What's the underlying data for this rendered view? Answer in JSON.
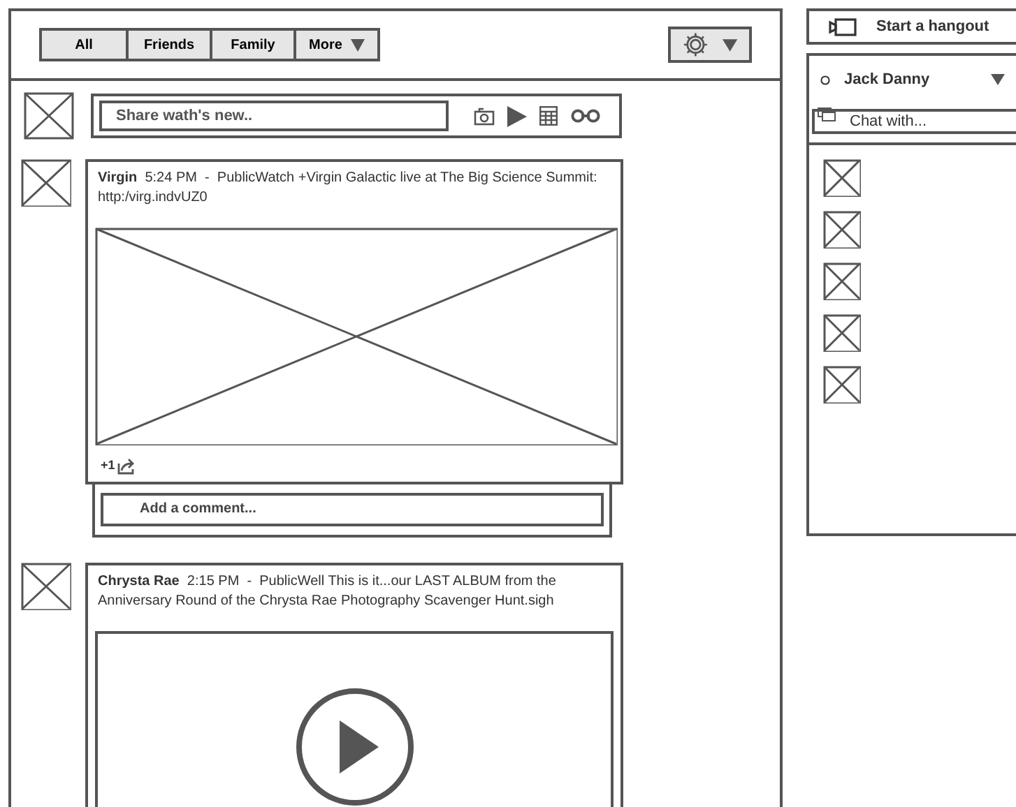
{
  "tabs": [
    {
      "label": "All"
    },
    {
      "label": "Friends"
    },
    {
      "label": "Family"
    },
    {
      "label": "More",
      "dropdown": true
    }
  ],
  "share": {
    "placeholder": "Share wath's new.."
  },
  "posts": [
    {
      "text": "**Virgin**  5:24 PM  -  PublicWatch +Virgin Galactic live at The Big Science Summit: http:/virg.indvUZ0",
      "kind": "image",
      "plus": "+1",
      "comment_placeholder": "Add a comment..."
    },
    {
      "text": "**Chrysta Rae**  2:15 PM  -  PublicWell This is it...our LAST ALBUM from the Anniversary Round of the Chrysta Rae Photography Scavenger Hunt.sigh",
      "kind": "video"
    }
  ],
  "sidebar": {
    "hangout": "Start a hangout",
    "user": "Jack Danny",
    "chat_placeholder": "Chat with...",
    "contacts": [
      {
        "kind": "avatar"
      },
      {
        "kind": "avatar"
      },
      {
        "kind": "avatar"
      },
      {
        "kind": "avatar"
      },
      {
        "kind": "avatar"
      }
    ]
  }
}
